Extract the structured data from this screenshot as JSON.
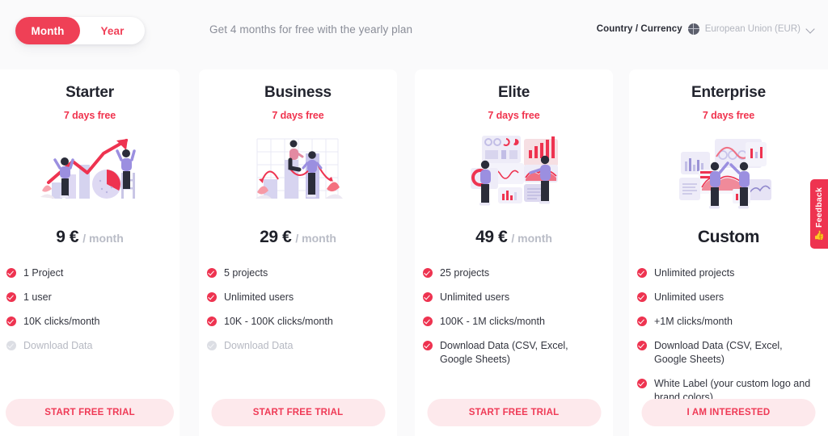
{
  "header": {
    "billing_toggle": {
      "name": "billing-period-toggle",
      "options": [
        {
          "label": "Month",
          "active": true
        },
        {
          "label": "Year",
          "active": false
        }
      ]
    },
    "promo_text": "Get 4 months for free with the yearly plan",
    "currency_selector": {
      "label": "Country / Currency",
      "icon": "globe-icon",
      "value": "European Union (EUR)",
      "chevron": "chevron-down-icon"
    }
  },
  "plans": [
    {
      "name": "Starter",
      "trial": "7 days free",
      "price_amount": "9 €",
      "price_period": "/ month",
      "illustration": "growth-arrow-chart-illustration",
      "features": [
        {
          "text": "1 Project",
          "included": true
        },
        {
          "text": "1 user",
          "included": true
        },
        {
          "text": "10K clicks/month",
          "included": true
        },
        {
          "text": "Download Data",
          "included": false
        }
      ],
      "cta": "START FREE TRIAL"
    },
    {
      "name": "Business",
      "trial": "7 days free",
      "price_amount": "29 €",
      "price_period": "/ month",
      "illustration": "bar-chart-people-illustration",
      "features": [
        {
          "text": "5 projects",
          "included": true
        },
        {
          "text": "Unlimited users",
          "included": true
        },
        {
          "text": "10K - 100K clicks/month",
          "included": true
        },
        {
          "text": "Download Data",
          "included": false
        }
      ],
      "cta": "START FREE TRIAL"
    },
    {
      "name": "Elite",
      "trial": "7 days free",
      "price_amount": "49 €",
      "price_period": "/ month",
      "illustration": "analytics-dashboard-illustration",
      "features": [
        {
          "text": "25 projects",
          "included": true
        },
        {
          "text": "Unlimited users",
          "included": true
        },
        {
          "text": "100K - 1M clicks/month",
          "included": true
        },
        {
          "text": "Download Data (CSV, Excel, Google Sheets)",
          "included": true
        }
      ],
      "cta": "START FREE TRIAL"
    },
    {
      "name": "Enterprise",
      "trial": "7 days free",
      "price_custom": "Custom",
      "illustration": "enterprise-dashboard-illustration",
      "features": [
        {
          "text": "Unlimited projects",
          "included": true
        },
        {
          "text": "Unlimited users",
          "included": true
        },
        {
          "text": "+1M clicks/month",
          "included": true
        },
        {
          "text": "Download Data (CSV, Excel, Google Sheets)",
          "included": true
        },
        {
          "text": "White Label (your custom logo and brand colors)",
          "included": true
        }
      ],
      "cta": "I AM INTERESTED"
    }
  ],
  "feedback_tab": {
    "label": "Feedback",
    "icon": "thumbs-up-icon"
  },
  "colors": {
    "accent": "#ef4056",
    "accent_deep": "#ee3350",
    "cta_bg": "#fde9ec",
    "page_bg": "#fafafb",
    "card_bg": "#ffffff",
    "text_dark": "#22242e",
    "text_muted": "#8a8d98",
    "text_disabled": "#b6b9c2",
    "illustration_lilac": "#cfcdf0"
  }
}
